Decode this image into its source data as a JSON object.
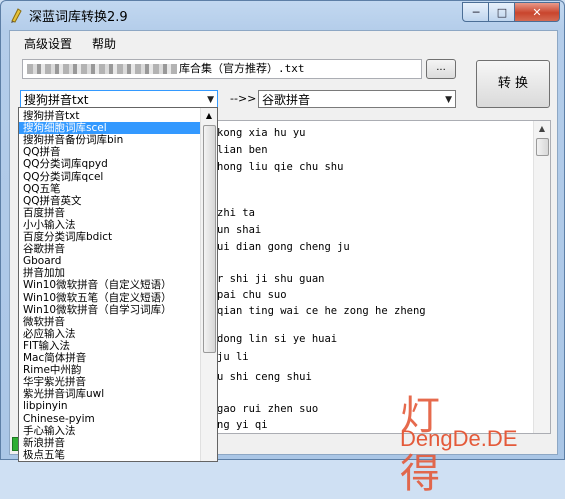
{
  "window": {
    "title": "深蓝词库转换2.9",
    "min": "─",
    "max": "□",
    "close": "✕"
  },
  "menu": [
    "高级设置",
    "帮助"
  ],
  "path": {
    "suffix": "库合集（官方推荐）.txt",
    "browse": "..."
  },
  "convert_label": "转 换",
  "source_combo": "搜狗拼音txt",
  "arrow_label": "-->>",
  "target_combo": "谷歌拼音",
  "editor_lines": [
    "kong xia hu yu",
    "lian ben",
    "hong liu qie chu shu",
    "zhi ta",
    "un shai",
    "ui dian gong cheng ju",
    "r shi ji shu guan",
    "pai chu suo",
    "qian ting wai ce he zong he zheng",
    "dong lin si ye huai",
    "ju li",
    "u shi ceng shui",
    "gao rui zhen suo",
    "ng yi qi"
  ],
  "dropdown": {
    "selected_index": 1,
    "items": [
      "搜狗拼音txt",
      "搜狗细胞词库scel",
      "搜狗拼音备份词库bin",
      "QQ拼音",
      "QQ分类词库qpyd",
      "QQ分类词库qcel",
      "QQ五笔",
      "QQ拼音英文",
      "百度拼音",
      "小小输入法",
      "百度分类词库bdict",
      "谷歌拼音",
      "Gboard",
      "拼音加加",
      "Win10微软拼音（自定义短语）",
      "Win10微软五笔（自定义短语）",
      "Win10微软拼音（自学习词库）",
      "微软拼音",
      "必应输入法",
      "FIT输入法",
      "Mac简体拼音",
      "Rime中州韵",
      "华宇紫光拼音",
      "紫光拼音词库uwl",
      "libpinyin",
      "Chinese-pyim",
      "手心输入法",
      "新浪拼音",
      "极点五笔"
    ]
  },
  "watermark": {
    "glyphs": "灯 得",
    "text": "DengDe.DE"
  },
  "colors": {
    "selection": "#3399ff",
    "watermark": "#e45a3a",
    "progress": "#2fae34"
  }
}
